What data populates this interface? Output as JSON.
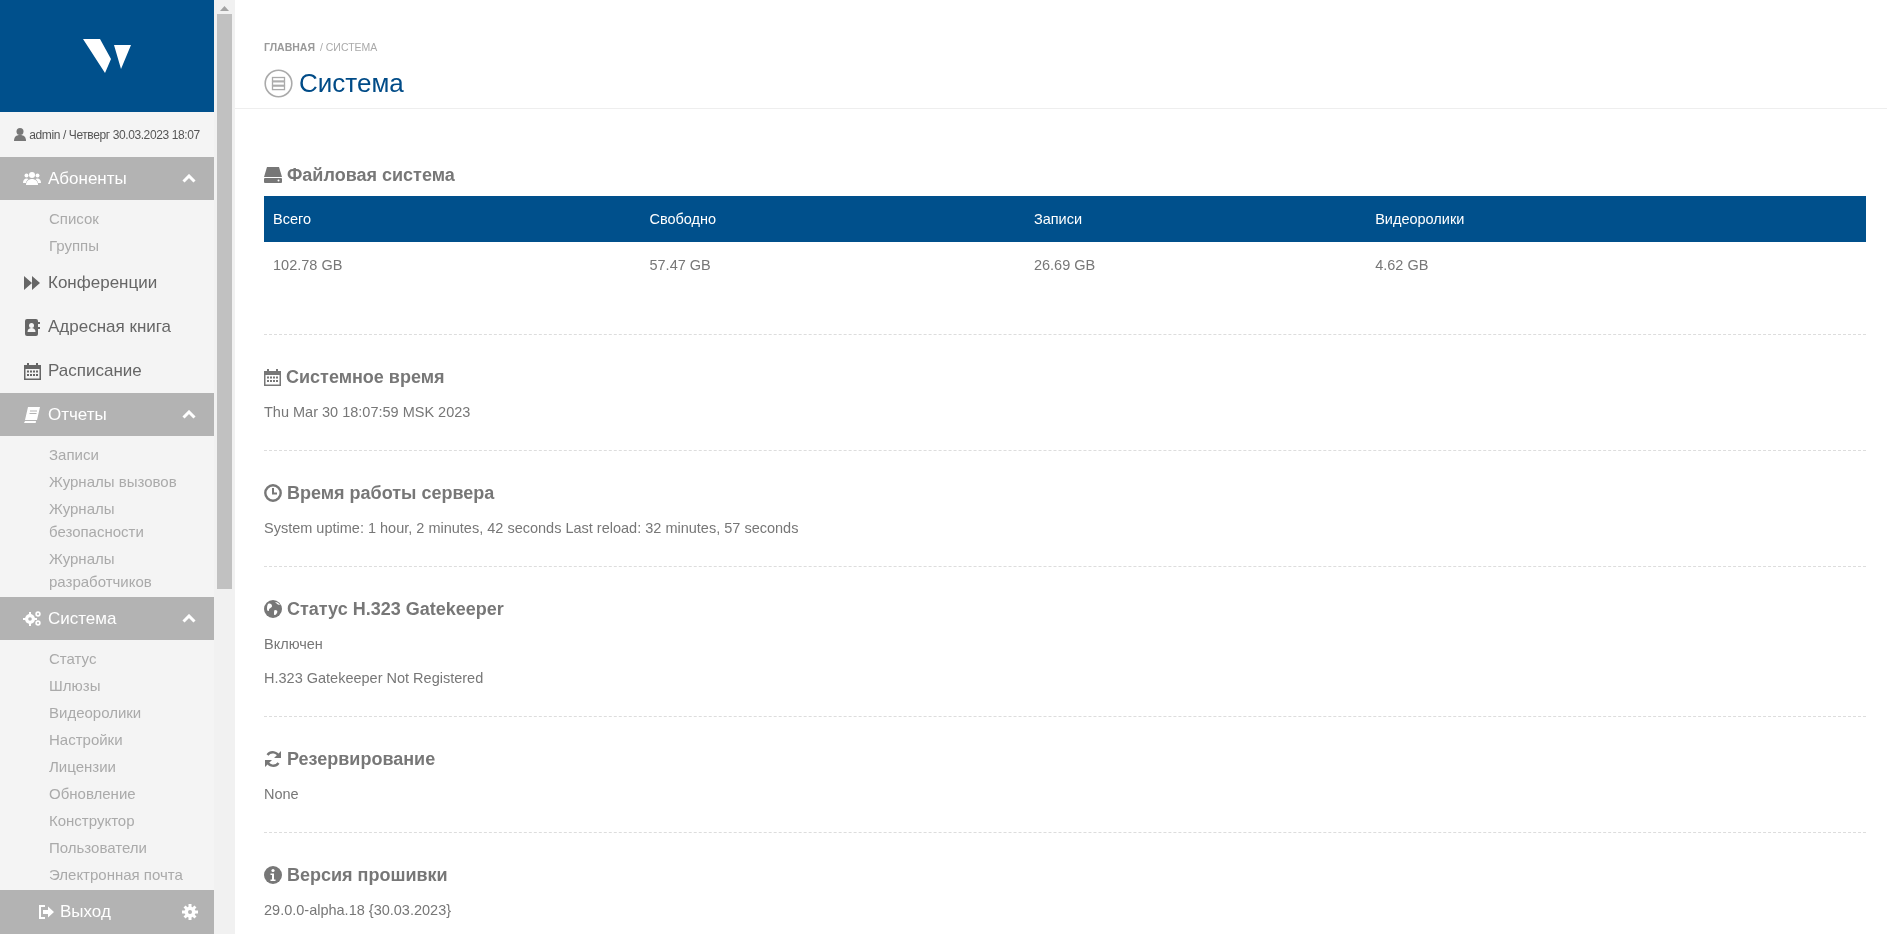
{
  "sidebar": {
    "user": "admin / Четверг 30.03.2023 18:07",
    "nav": [
      {
        "kind": "group",
        "label": "Абоненты",
        "expanded": true,
        "children": [
          {
            "label": "Список"
          },
          {
            "label": "Группы"
          }
        ]
      },
      {
        "kind": "item",
        "label": "Конференции"
      },
      {
        "kind": "item",
        "label": "Адресная книга"
      },
      {
        "kind": "item",
        "label": "Расписание"
      },
      {
        "kind": "group",
        "label": "Отчеты",
        "expanded": true,
        "children": [
          {
            "label": "Записи"
          },
          {
            "label": "Журналы вызовов"
          },
          {
            "label": "Журналы безопасности"
          },
          {
            "label": "Журналы разработчиков"
          }
        ]
      },
      {
        "kind": "group",
        "label": "Система",
        "expanded": true,
        "children": [
          {
            "label": "Статус"
          },
          {
            "label": "Шлюзы"
          },
          {
            "label": "Видеоролики"
          },
          {
            "label": "Настройки"
          },
          {
            "label": "Лицензии"
          },
          {
            "label": "Обновление"
          },
          {
            "label": "Конструктор"
          },
          {
            "label": "Пользователи"
          },
          {
            "label": "Электронная почта"
          }
        ]
      }
    ],
    "logout": "Выход"
  },
  "breadcrumb": [
    "ГЛАВНАЯ",
    "/ СИСТЕМА"
  ],
  "title": "Система",
  "sections": [
    {
      "kind": "table",
      "title": "Файловая система",
      "columns": [
        "Всего",
        "Свободно",
        "Записи",
        "Видеоролики"
      ],
      "rows": [
        [
          "102.78 GB",
          "57.47 GB",
          "26.69 GB",
          "4.62 GB"
        ]
      ]
    },
    {
      "kind": "text",
      "title": "Системное время",
      "lines": [
        "Thu Mar 30 18:07:59 MSK 2023"
      ]
    },
    {
      "kind": "text",
      "title": "Время работы сервера",
      "lines": [
        "System uptime: 1 hour, 2 minutes, 42 seconds Last reload: 32 minutes, 57 seconds"
      ]
    },
    {
      "kind": "text",
      "title": "Статус H.323 Gatekeeper",
      "lines": [
        "Включен",
        "H.323 Gatekeeper Not Registered"
      ]
    },
    {
      "kind": "text",
      "title": "Резервирование",
      "lines": [
        "None"
      ]
    },
    {
      "kind": "text",
      "title": "Версия прошивки",
      "lines": [
        "29.0.0-alpha.18 {30.03.2023}"
      ]
    }
  ]
}
